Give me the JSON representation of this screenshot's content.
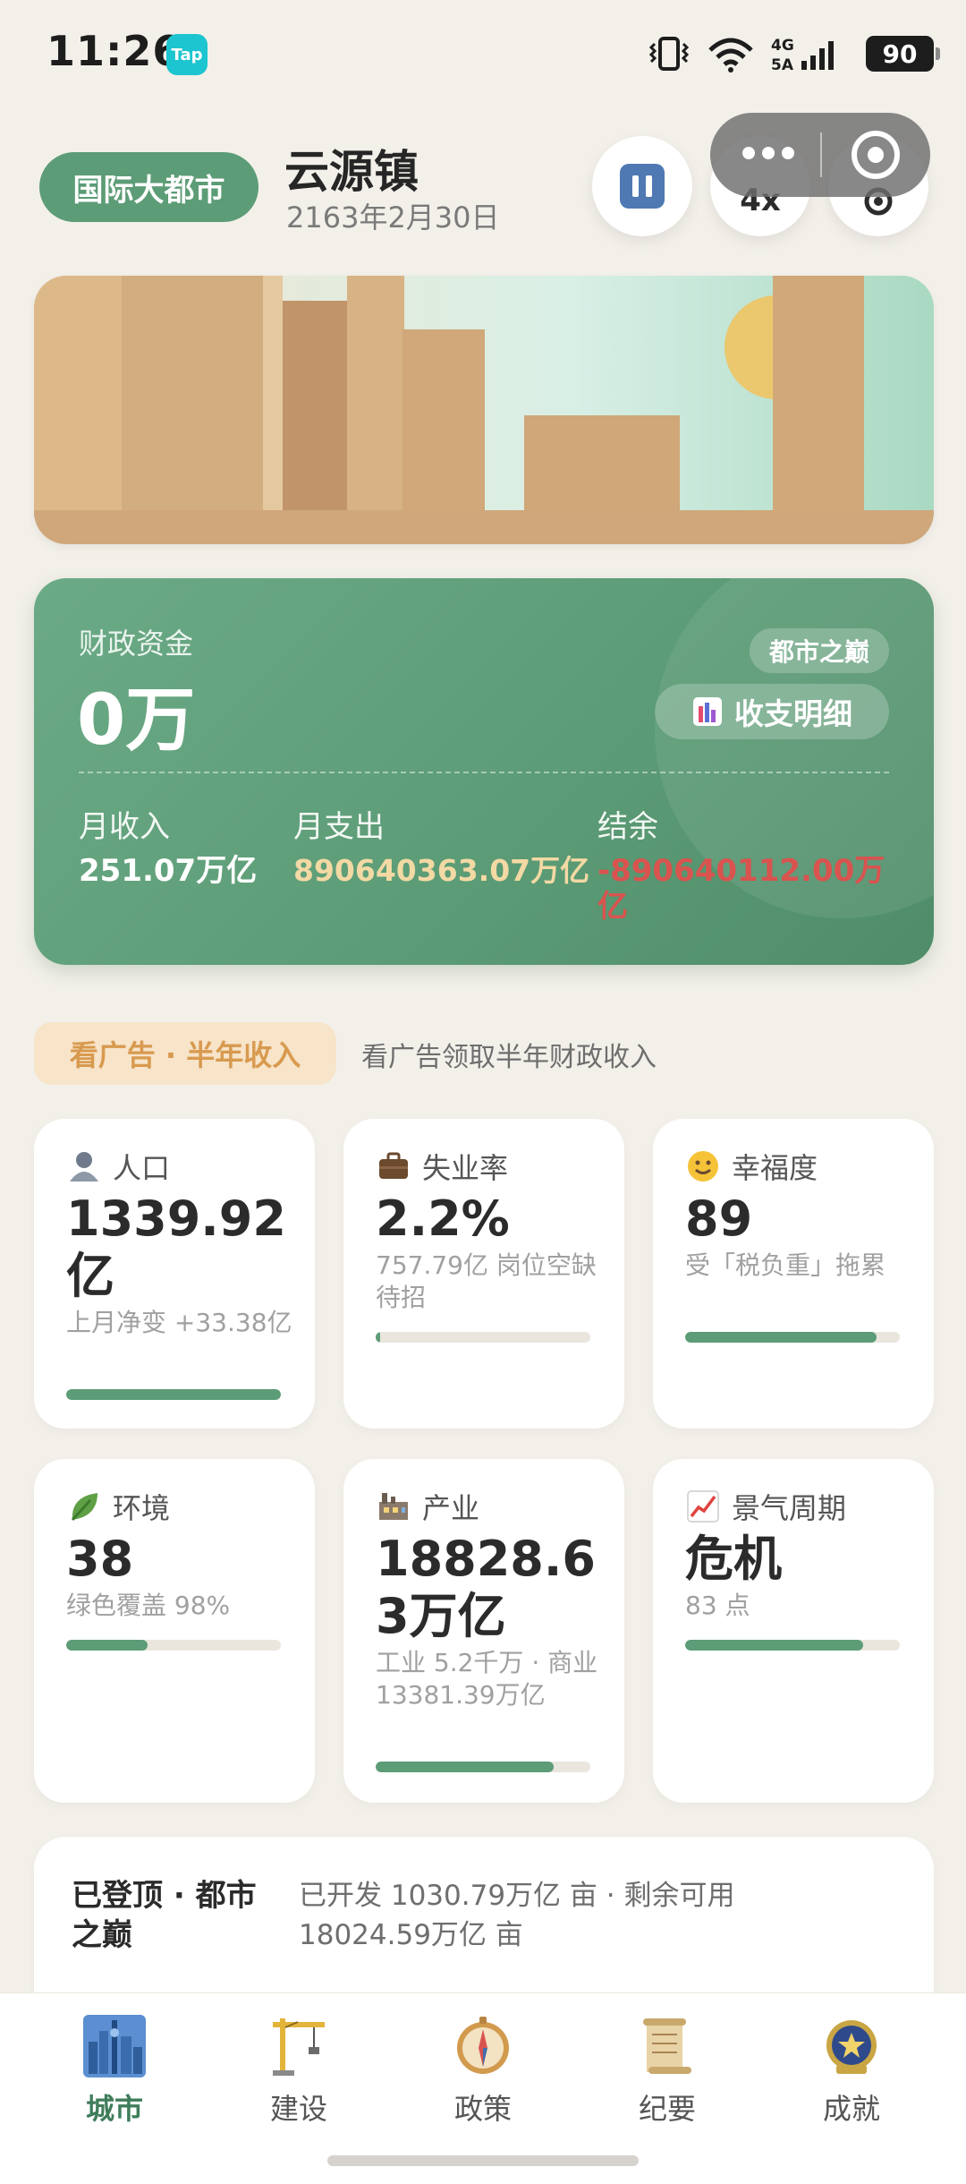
{
  "status_bar": {
    "time": "11:26",
    "app_badge": "Tap",
    "network": "4G 5A",
    "battery": "90"
  },
  "header": {
    "city_level": "国际大都市",
    "town_name": "云源镇",
    "date": "2163年2月30日",
    "speed_label": "4x"
  },
  "finance": {
    "funds_label": "财政资金",
    "funds_value": "0万",
    "rank_label": "都市之巅",
    "detail_button": "收支明细",
    "income_label": "月收入",
    "income_value": "251.07万亿",
    "expense_label": "月支出",
    "expense_value": "890640363.07万亿",
    "balance_label": "结余",
    "balance_value": "-890640112.00万亿",
    "colors": {
      "expense": "#F3D9A4",
      "balance": "#D9534F"
    }
  },
  "ad": {
    "button_label": "看广告 · 半年收入",
    "description": "看广告领取半年财政收入"
  },
  "stats": {
    "population": {
      "icon": "person-icon",
      "title": "人口",
      "value": "1339.92亿",
      "sub": "上月净变 +33.38亿",
      "progress": 1.0
    },
    "unemployment": {
      "icon": "briefcase-icon",
      "title": "失业率",
      "value": "2.2%",
      "sub": "757.79亿 岗位空缺待招",
      "progress": 0.02
    },
    "happiness": {
      "icon": "smile-icon",
      "title": "幸福度",
      "value": "89",
      "sub": "受「税负重」拖累",
      "progress": 0.89
    },
    "environment": {
      "icon": "leaf-icon",
      "title": "环境",
      "value": "38",
      "sub": "绿色覆盖 98%",
      "progress": 0.38
    },
    "industry": {
      "icon": "factory-icon",
      "title": "产业",
      "value": "18828.63万亿",
      "sub": "工业 5.2千万 · 商业 13381.39万亿",
      "progress": 0.83
    },
    "economy": {
      "icon": "chart-up-icon",
      "title": "景气周期",
      "value": "危机",
      "sub": "83 点",
      "progress": 0.83
    }
  },
  "land": {
    "title": "已登顶 · 都市之巅",
    "info": "已开发 1030.79万亿 亩 · 剩余可用 18024.59万亿 亩"
  },
  "nav": [
    {
      "icon": "city-icon",
      "label": "城市",
      "active": true
    },
    {
      "icon": "crane-icon",
      "label": "建设",
      "active": false
    },
    {
      "icon": "compass-icon",
      "label": "政策",
      "active": false
    },
    {
      "icon": "scroll-icon",
      "label": "纪要",
      "active": false
    },
    {
      "icon": "medal-icon",
      "label": "成就",
      "active": false
    }
  ]
}
